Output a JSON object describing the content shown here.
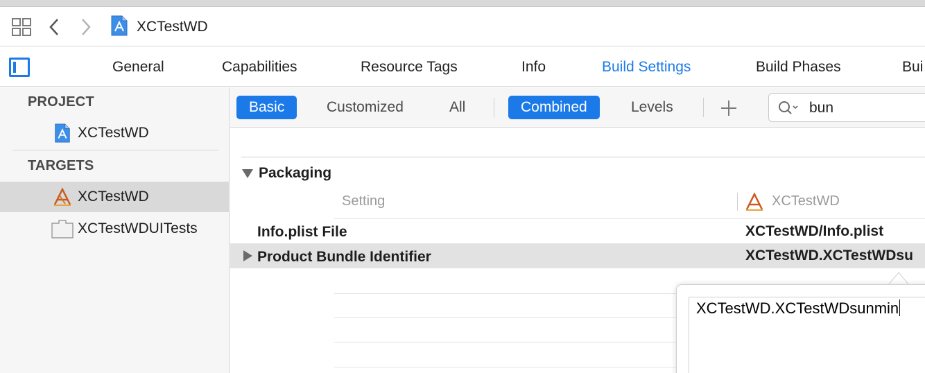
{
  "nav": {
    "title": "XCTestWD"
  },
  "tabs": [
    {
      "label": "General"
    },
    {
      "label": "Capabilities"
    },
    {
      "label": "Resource Tags"
    },
    {
      "label": "Info"
    },
    {
      "label": "Build Settings"
    },
    {
      "label": "Build Phases"
    },
    {
      "label": "Bui"
    }
  ],
  "sidebar": {
    "project_header": "PROJECT",
    "project_item": "XCTestWD",
    "targets_header": "TARGETS",
    "targets": [
      {
        "label": "XCTestWD"
      },
      {
        "label": "XCTestWDUITests"
      }
    ]
  },
  "filter": {
    "basic": "Basic",
    "customized": "Customized",
    "all": "All",
    "combined": "Combined",
    "levels": "Levels",
    "search_value": "bun"
  },
  "settings": {
    "section": "Packaging",
    "col_setting": "Setting",
    "col_target": "XCTestWD",
    "rows": [
      {
        "name": "Info.plist File",
        "value": "XCTestWD/Info.plist"
      },
      {
        "name": "Product Bundle Identifier",
        "value": "XCTestWD.XCTestWDsu"
      }
    ]
  },
  "popover": {
    "value": "XCTestWD.XCTestWDsunmin"
  },
  "colors": {
    "accent": "#1b7ae8",
    "selection": "#d9d9d9"
  }
}
